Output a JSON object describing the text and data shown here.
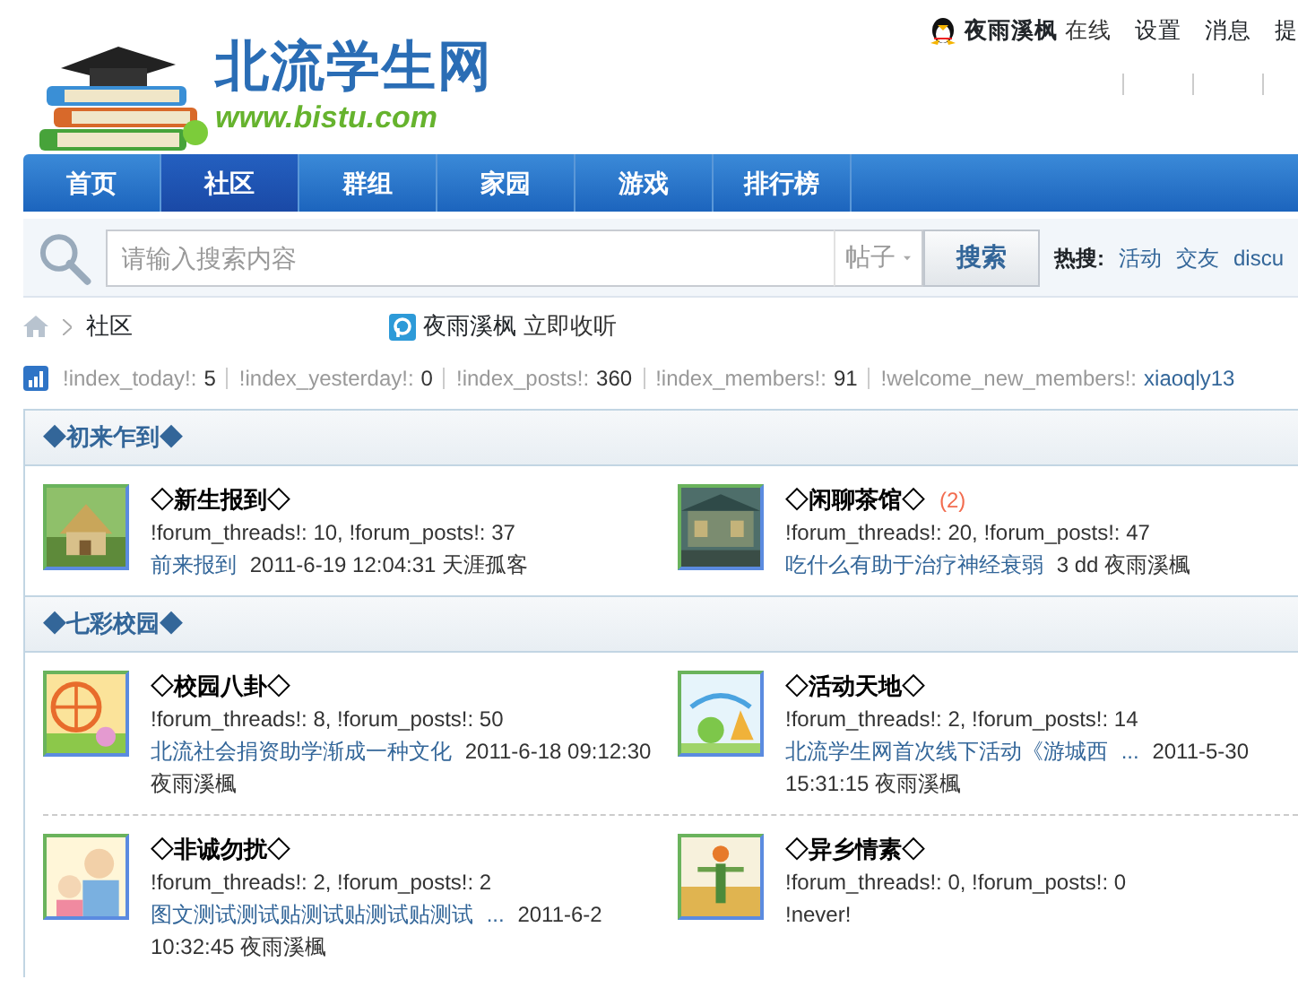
{
  "logo": {
    "title": "北流学生网",
    "url": "www.bistu.com"
  },
  "user_bar": {
    "username": "夜雨溪枫",
    "status": "在线",
    "links": [
      "设置",
      "消息",
      "提"
    ]
  },
  "nav": [
    {
      "label": "首页",
      "selected": false
    },
    {
      "label": "社区",
      "selected": true
    },
    {
      "label": "群组",
      "selected": false
    },
    {
      "label": "家园",
      "selected": false
    },
    {
      "label": "游戏",
      "selected": false
    },
    {
      "label": "排行榜",
      "selected": false
    }
  ],
  "search": {
    "placeholder": "请输入搜索内容",
    "scope": "帖子",
    "button": "搜索",
    "hot_label": "热搜:",
    "hot_terms": [
      "活动",
      "交友",
      "discu"
    ]
  },
  "breadcrumb": {
    "current": "社区",
    "follow_name": "夜雨溪枫",
    "follow_link": "立即收听"
  },
  "stats": [
    {
      "label": "!index_today!:",
      "value": "5"
    },
    {
      "label": "!index_yesterday!:",
      "value": "0"
    },
    {
      "label": "!index_posts!:",
      "value": "360"
    },
    {
      "label": "!index_members!:",
      "value": "91"
    },
    {
      "label": "!welcome_new_members!:",
      "value": "xiaoqly13",
      "kind": "link"
    }
  ],
  "sections": [
    {
      "title": "◆初来乍到◆",
      "forums": [
        {
          "name": "◇新生报到◇",
          "counts": "!forum_threads!: 10, !forum_posts!: 37",
          "last_post": {
            "title": "前来报到",
            "date": "2011-6-19 12:04:31",
            "author": "天涯孤客"
          }
        },
        {
          "name": "◇闲聊茶馆◇",
          "today": "(2)",
          "counts": "!forum_threads!: 20, !forum_posts!: 47",
          "last_post": {
            "title": "吃什么有助于治疗神经衰弱",
            "date": "3 dd",
            "author": "夜雨溪楓"
          }
        }
      ]
    },
    {
      "title": "◆七彩校园◆",
      "forums": [
        {
          "name": "◇校园八卦◇",
          "counts": "!forum_threads!: 8, !forum_posts!: 50",
          "last_post": {
            "title": "北流社会捐资助学渐成一种文化",
            "date": "2011-6-18 09:12:30",
            "author": "夜雨溪楓"
          }
        },
        {
          "name": "◇活动天地◇",
          "counts": "!forum_threads!: 2, !forum_posts!: 14",
          "last_post": {
            "title": "北流学生网首次线下活动《游城西",
            "more": "...",
            "date": "2011-5-30 15:31:15",
            "author": "夜雨溪楓"
          }
        },
        {
          "name": "◇非诚勿扰◇",
          "counts": "!forum_threads!: 2, !forum_posts!: 2",
          "last_post": {
            "title": "图文测试测试贴测试贴测试贴测试",
            "more": "...",
            "date": "2011-6-2 10:32:45",
            "author": "夜雨溪楓"
          }
        },
        {
          "name": "◇异乡情素◇",
          "counts": "!forum_threads!: 0, !forum_posts!: 0",
          "never": "!never!"
        }
      ]
    }
  ]
}
